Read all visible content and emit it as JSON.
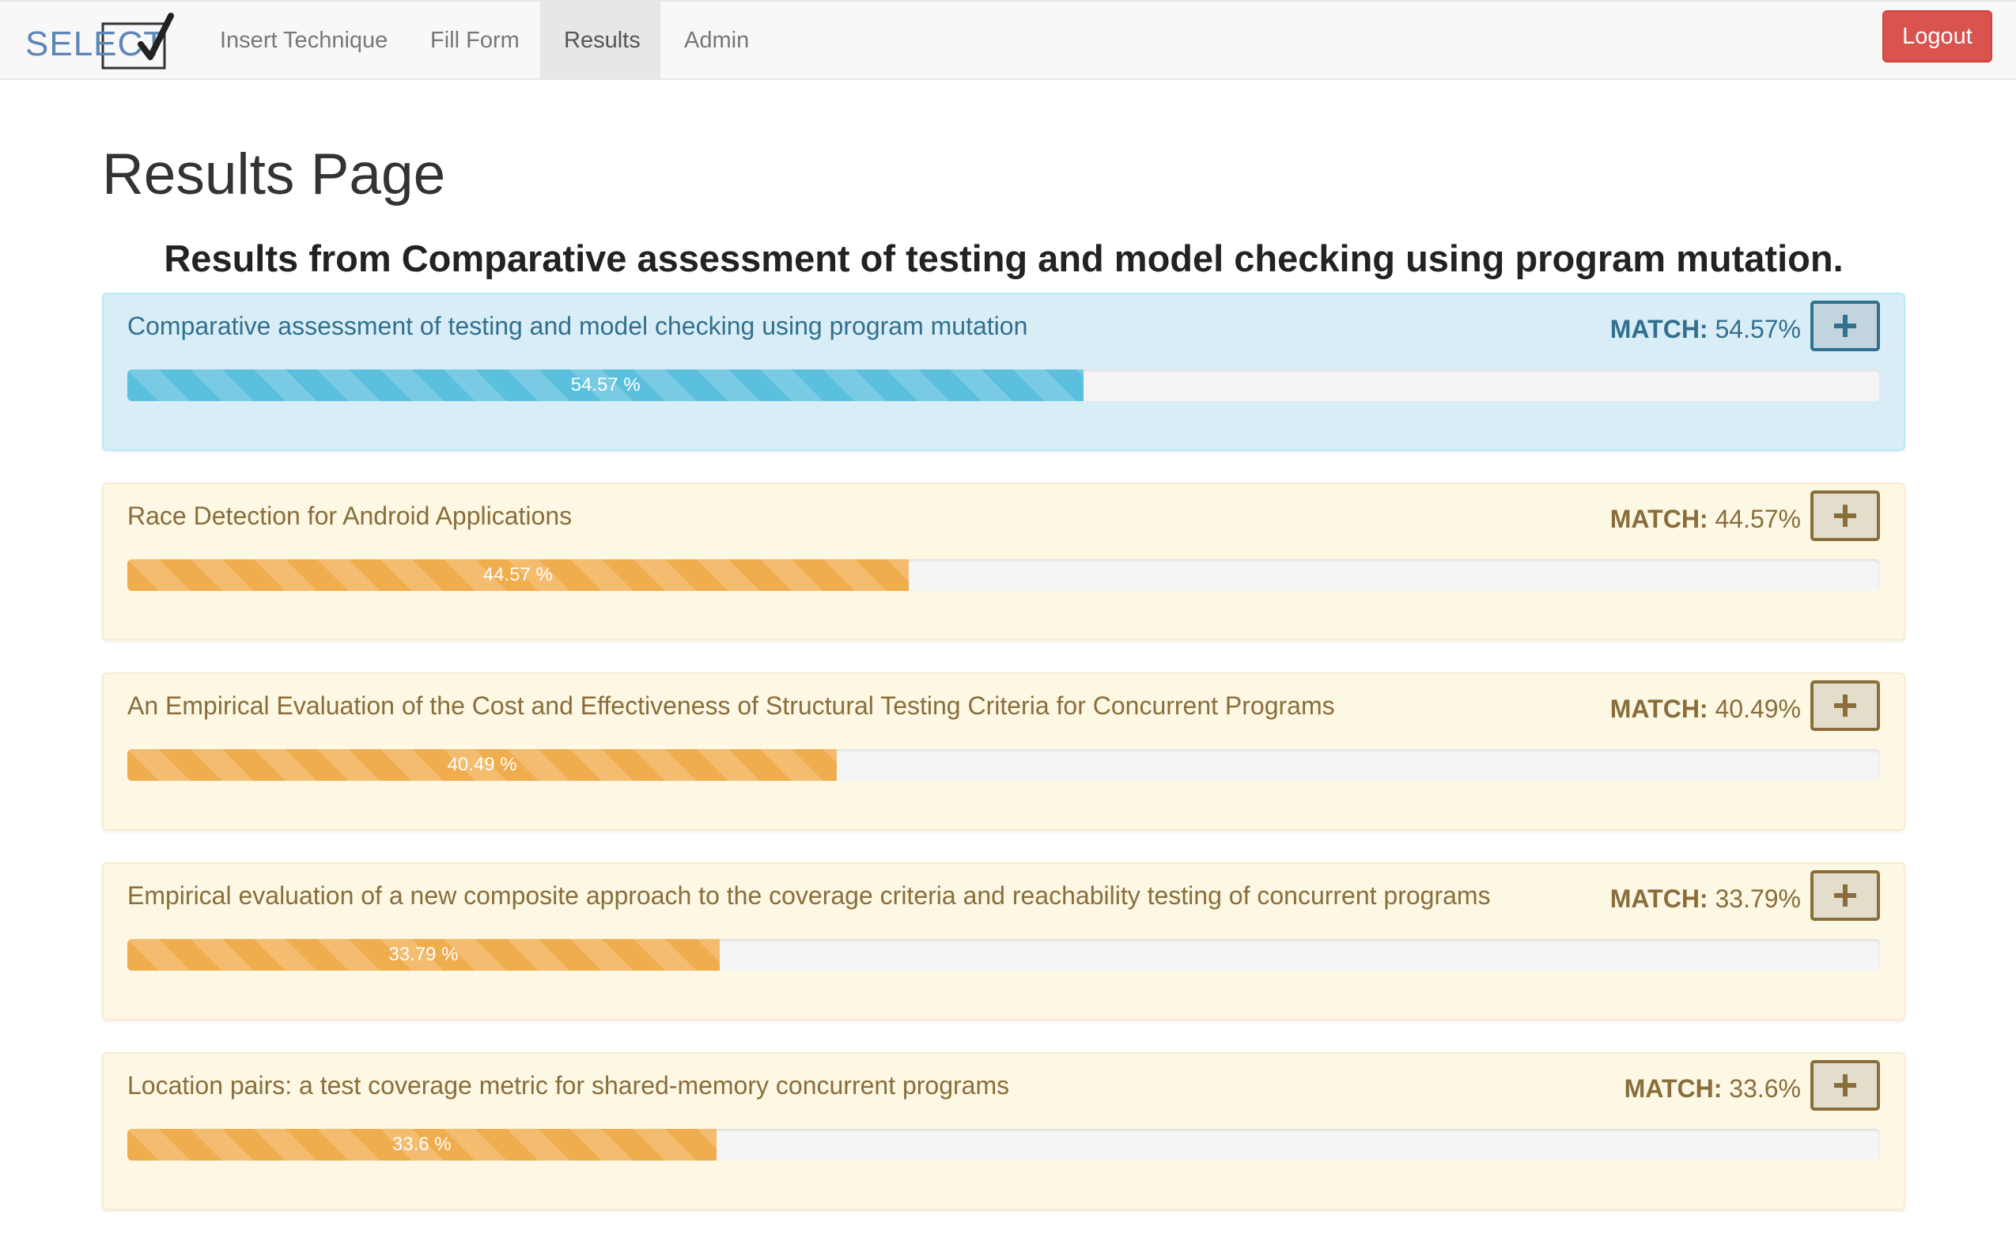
{
  "navbar": {
    "brand": "SELECT",
    "items": [
      {
        "label": "Insert Technique",
        "active": false
      },
      {
        "label": "Fill Form",
        "active": false
      },
      {
        "label": "Results",
        "active": true
      },
      {
        "label": "Admin",
        "active": false
      }
    ],
    "logout_label": "Logout"
  },
  "page": {
    "title": "Results Page",
    "subtitle": "Results from Comparative assessment of testing and model checking using program mutation."
  },
  "colors": {
    "info_bar": "#5bc0de",
    "warning_bar": "#f0ad4e",
    "logout": "#d9534f"
  },
  "results": [
    {
      "title": "Comparative assessment of testing and model checking using program mutation",
      "match_label": "MATCH:",
      "match_value": "54.57%",
      "bar_label": "54.57 %",
      "percent": 54.57,
      "style": "info"
    },
    {
      "title": "Race Detection for Android Applications",
      "match_label": "MATCH:",
      "match_value": "44.57%",
      "bar_label": "44.57 %",
      "percent": 44.57,
      "style": "warning"
    },
    {
      "title": "An Empirical Evaluation of the Cost and Effectiveness of Structural Testing Criteria for Concurrent Programs",
      "match_label": "MATCH:",
      "match_value": "40.49%",
      "bar_label": "40.49 %",
      "percent": 40.49,
      "style": "warning"
    },
    {
      "title": "Empirical evaluation of a new composite approach to the coverage criteria and reachability testing of concurrent programs",
      "match_label": "MATCH:",
      "match_value": "33.79%",
      "bar_label": "33.79 %",
      "percent": 33.79,
      "style": "warning"
    },
    {
      "title": "Location pairs: a test coverage metric for shared-memory concurrent programs",
      "match_label": "MATCH:",
      "match_value": "33.6%",
      "bar_label": "33.6 %",
      "percent": 33.6,
      "style": "warning"
    }
  ]
}
